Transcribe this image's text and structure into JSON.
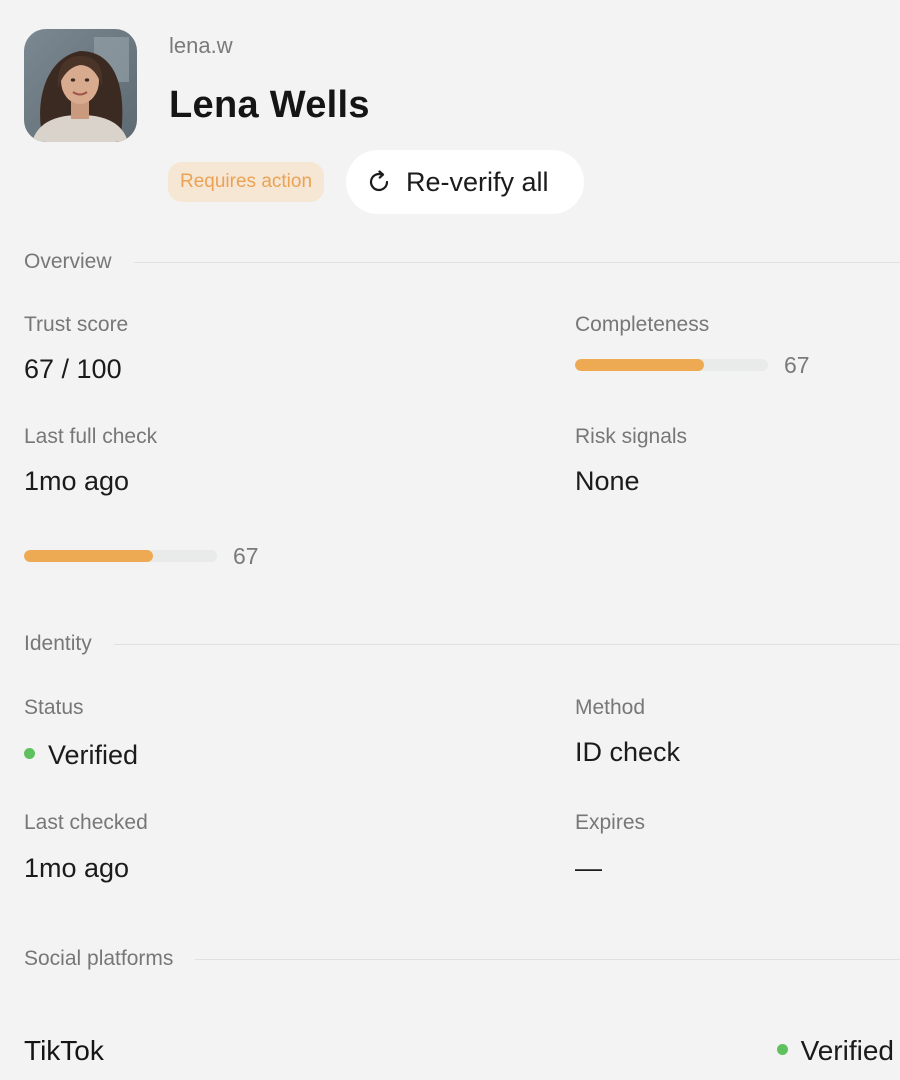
{
  "profile": {
    "handle": "lena.w",
    "name": "Lena Wells",
    "badge": "Requires action",
    "reverify_label": "Re-verify all"
  },
  "overview": {
    "section_title": "Overview",
    "trust_score_label": "Trust score",
    "trust_score_value": "67 / 100",
    "completeness_label": "Completeness",
    "completeness_value": "67",
    "completeness_fraction": 0.67,
    "last_full_check_label": "Last full check",
    "last_full_check_value": "1mo ago",
    "risk_signals_label": "Risk signals",
    "risk_signals_value": "None",
    "score_bar_value": "67",
    "score_bar_fraction": 0.67
  },
  "identity": {
    "section_title": "Identity",
    "status_label": "Status",
    "status_value": "Verified",
    "method_label": "Method",
    "method_value": "ID check",
    "last_checked_label": "Last checked",
    "last_checked_value": "1mo ago",
    "expires_label": "Expires",
    "expires_value": "—"
  },
  "social": {
    "section_title": "Social platforms",
    "platforms": [
      {
        "name": "TikTok",
        "status": "Verified"
      }
    ]
  },
  "colors": {
    "accent_orange": "#eeaa53",
    "badge_bg": "#f6e6d4",
    "badge_text": "#eba253",
    "verified_green": "#5ec15d",
    "page_bg": "#f2f3f2"
  },
  "icons": {
    "reverify": "refresh-icon",
    "status_dot": "status-dot-icon"
  }
}
